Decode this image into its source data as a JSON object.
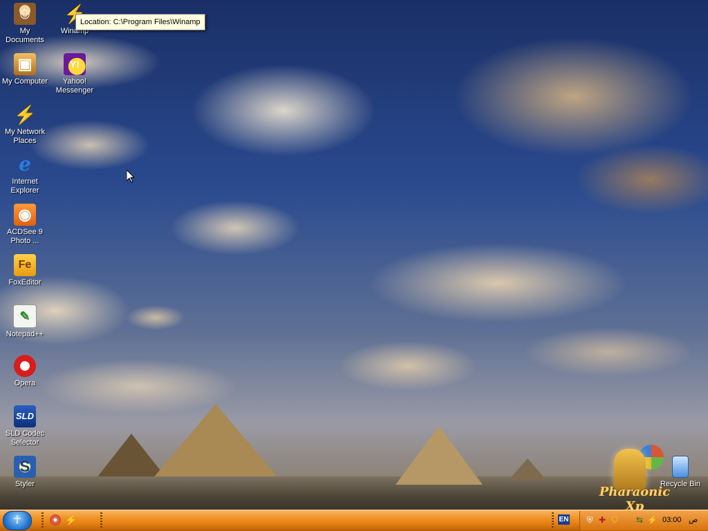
{
  "desktop": {
    "brand_logo_text": "Pharaonic Xp",
    "icons": [
      {
        "name": "my-documents",
        "label": "My\nDocuments",
        "glyph": "☺"
      },
      {
        "name": "my-computer",
        "label": "My Computer",
        "glyph": "▣"
      },
      {
        "name": "my-network-places",
        "label": "My Network\nPlaces",
        "glyph": "⚡"
      },
      {
        "name": "internet-explorer",
        "label": "Internet\nExplorer",
        "glyph": "e"
      },
      {
        "name": "acdsee",
        "label": "ACDSee 9\nPhoto ...",
        "glyph": "◉"
      },
      {
        "name": "foxeditor",
        "label": "FoxEditor",
        "glyph": "Fe"
      },
      {
        "name": "notepad-plus-plus",
        "label": "Notepad++",
        "glyph": "✎"
      },
      {
        "name": "opera",
        "label": "Opera",
        "glyph": "O"
      },
      {
        "name": "sld-codec-selector",
        "label": "SLD Codec\nSelector",
        "glyph": "SLD"
      },
      {
        "name": "styler",
        "label": "Styler",
        "glyph": "S"
      },
      {
        "name": "winamp",
        "label": "Winamp",
        "glyph": "⚡"
      },
      {
        "name": "yahoo-messenger",
        "label": "Yahoo!\nMessenger",
        "glyph": "Y!"
      },
      {
        "name": "recycle-bin",
        "label": "Recycle Bin",
        "glyph": ""
      }
    ],
    "tooltip": "Location: C:\\Program Files\\Winamp"
  },
  "taskbar": {
    "start_glyph": "☥",
    "language": "EN",
    "clock": "03:00",
    "ampm": "ص",
    "tray_icons": [
      "shield-icon",
      "antivirus-icon",
      "security-alert-icon",
      "network-icon",
      "winamp-tray-icon"
    ]
  },
  "colors": {
    "taskbar_orange": "#f39a2c",
    "label_text": "#ffffff",
    "tooltip_bg": "#ffffe1"
  }
}
